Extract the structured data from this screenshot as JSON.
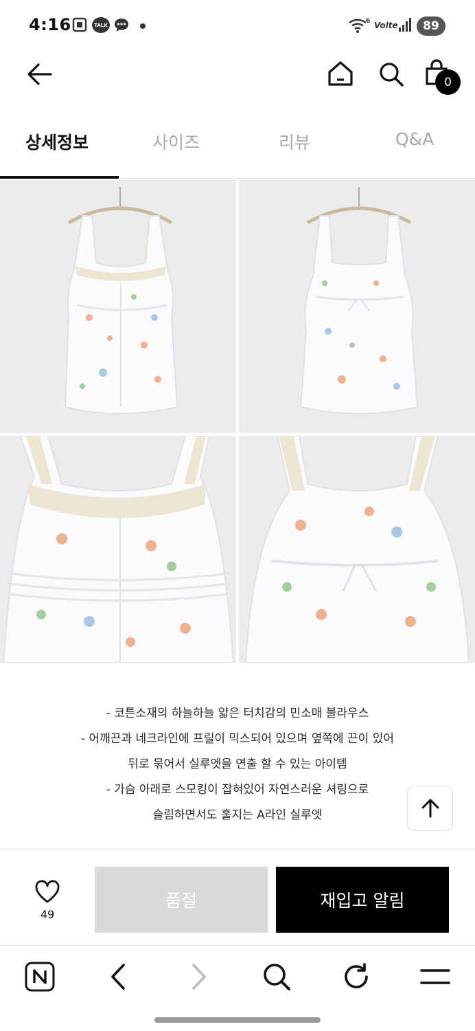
{
  "status_bar": {
    "time": "4:16",
    "talk_badge": "TALK",
    "battery": "89",
    "network": "Volte",
    "wifi_badge": "6"
  },
  "header": {
    "cart_count": "0"
  },
  "tabs": [
    {
      "label": "상세정보",
      "active": true
    },
    {
      "label": "사이즈",
      "active": false
    },
    {
      "label": "리뷰",
      "active": false
    },
    {
      "label": "Q&A",
      "active": false
    }
  ],
  "description": [
    "- 코튼소재의 하늘하늘 얇은 터치감의 민소매 블라우스",
    "- 어깨끈과 네크라인에 프릴이 믹스되어 있으며 옆쪽에 끈이 있어",
    "뒤로 묶어서 실루엣을 연출 할 수 있는 아이템",
    "- 가슴 아래로 스모킹이 잡혀있어 자연스러운 셔링으로",
    "슬림하면서도 훌지는 A라인 실루엣"
  ],
  "action_bar": {
    "wish_count": "49",
    "soldout_label": "품절",
    "restock_label": "재입고 알림"
  },
  "colors": {
    "accent": "#000000",
    "tab_inactive": "#a8a8a8",
    "soldout_bg": "#d9d9d9",
    "photo_bg": "#ececec"
  },
  "icons": {
    "header": [
      "back-arrow-icon",
      "home-icon",
      "search-icon",
      "shopping-bag-icon"
    ],
    "browser": [
      "naver-n-icon",
      "back-chevron-icon",
      "forward-chevron-icon",
      "search-icon",
      "refresh-icon",
      "menu-icon"
    ]
  }
}
